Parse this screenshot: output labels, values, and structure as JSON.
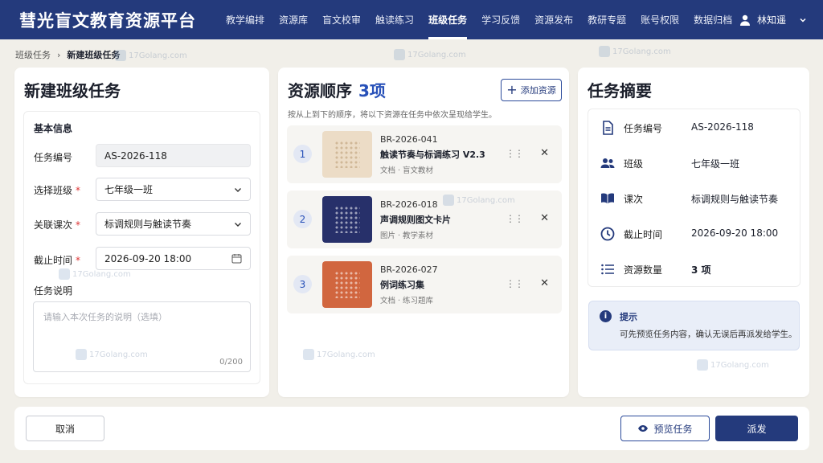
{
  "app": {
    "title": "彗光盲文教育资源平台"
  },
  "nav": [
    {
      "label": "教学编排"
    },
    {
      "label": "资源库"
    },
    {
      "label": "盲文校审"
    },
    {
      "label": "触读练习"
    },
    {
      "label": "班级任务",
      "active": true
    },
    {
      "label": "学习反馈"
    },
    {
      "label": "资源发布"
    },
    {
      "label": "教研专题"
    },
    {
      "label": "账号权限"
    },
    {
      "label": "数据归档"
    }
  ],
  "user": {
    "name": "林知遥",
    "icon": "user-icon"
  },
  "breadcrumb": {
    "parent": "班级任务",
    "current": "新建班级任务"
  },
  "form": {
    "title": "新建班级任务",
    "section": "基本信息",
    "task_id_label": "任务编号",
    "task_id_value": "AS-2026-118",
    "class_label": "选择班级",
    "class_value": "七年级一班",
    "lesson_label": "关联课次",
    "lesson_value": "标调规则与触读节奏",
    "deadline_label": "截止时间",
    "deadline_value": "2026-09-20 18:00",
    "desc_label": "任务说明",
    "desc_placeholder": "请输入本次任务的说明（选填）",
    "desc_count": "0/200"
  },
  "resources": {
    "title": "资源顺序",
    "count": "3项",
    "add_label": "添加资源",
    "hint": "按从上到下的顺序，将以下资源在任务中依次呈现给学生。",
    "items": [
      {
        "num": "1",
        "id": "BR-2026-041",
        "name": "触读节奏与标调练习 V2.3",
        "meta": "文档 · 盲文教材",
        "color": "#ecdcc6"
      },
      {
        "num": "2",
        "id": "BR-2026-018",
        "name": "声调规则图文卡片",
        "meta": "图片 · 教学素材",
        "color": "#27306a"
      },
      {
        "num": "3",
        "id": "BR-2026-027",
        "name": "例词练习集",
        "meta": "文档 · 练习题库",
        "color": "#d1663f"
      }
    ]
  },
  "summary": {
    "title": "任务摘要",
    "rows": [
      {
        "label": "任务编号",
        "value": "AS-2026-118",
        "icon": "document-icon"
      },
      {
        "label": "班级",
        "value": "七年级一班",
        "icon": "users-icon"
      },
      {
        "label": "课次",
        "value": "标调规则与触读节奏",
        "icon": "book-icon"
      },
      {
        "label": "截止时间",
        "value": "2026-09-20 18:00",
        "icon": "clock-icon"
      },
      {
        "label": "资源数量",
        "value": "3 项",
        "icon": "list-icon"
      }
    ],
    "tip_title": "提示",
    "tip_text": "可先预览任务内容，确认无误后再派发给学生。"
  },
  "footer": {
    "cancel": "取消",
    "preview": "预览任务",
    "send": "派发"
  },
  "watermark": "17Golang.com"
}
